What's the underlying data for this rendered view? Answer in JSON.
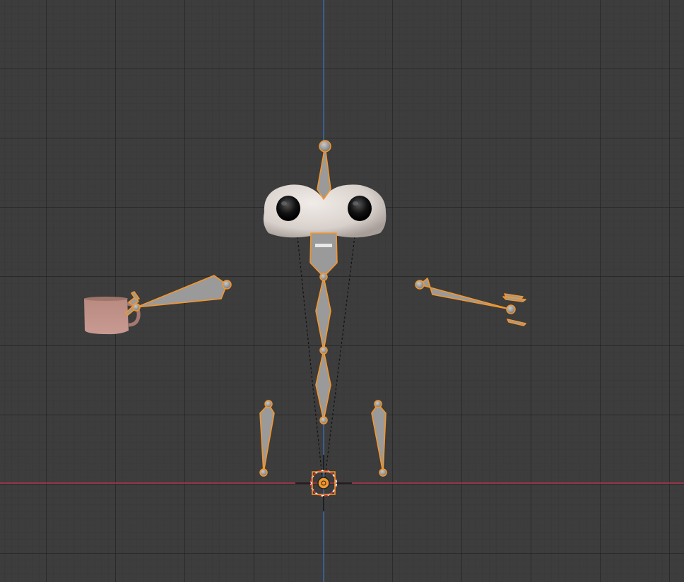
{
  "viewport": {
    "grid_major_color": "#2a2a2a",
    "grid_minor_color": "#3a3a3a",
    "background_color": "#3d3d3d",
    "x_axis_color": "#b5334c",
    "z_axis_color": "#3b6fb0",
    "selection_color": "#f5962a",
    "bone_color": "#9a9a9a"
  },
  "objects": {
    "armature": "armature-rig",
    "head_mesh": "head-with-eyes",
    "cup": "cup-mesh",
    "origin": "object-origin-icon"
  }
}
